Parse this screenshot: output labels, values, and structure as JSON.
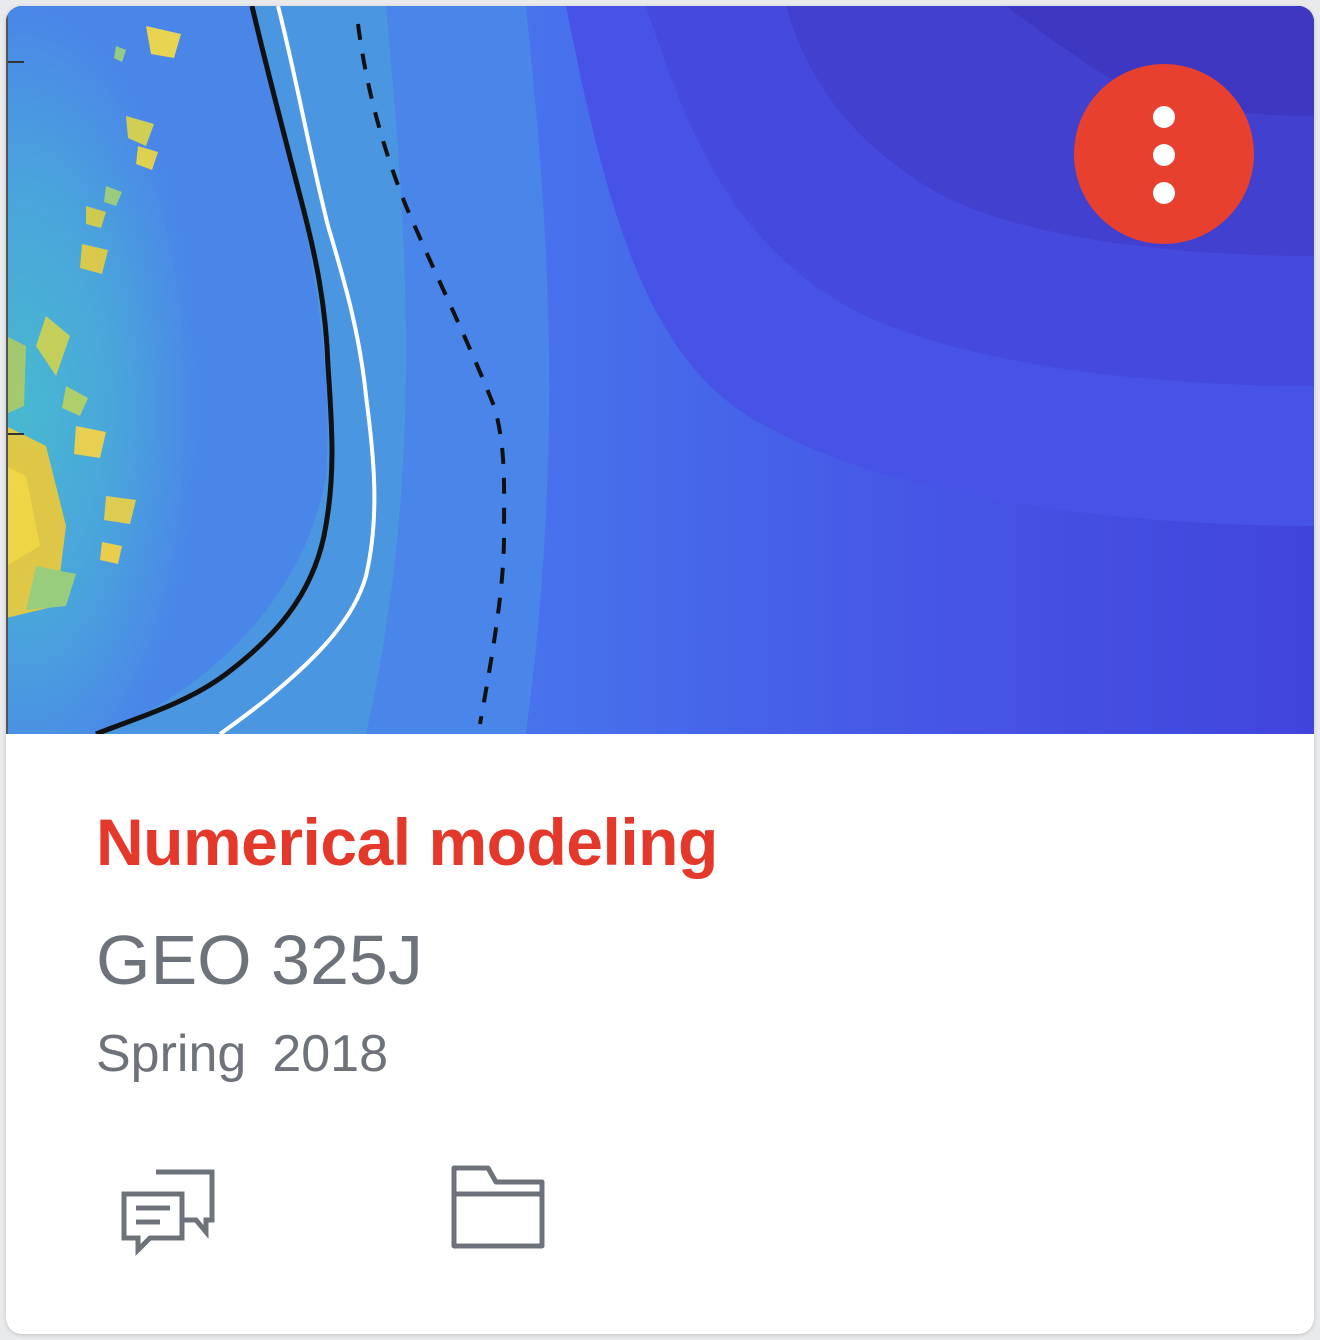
{
  "course": {
    "title": "Numerical modeling",
    "code": "GEO 325J",
    "term": {
      "season": "Spring",
      "year": "2018"
    }
  },
  "icons": {
    "menu": "more-vert-icon",
    "discussions": "discussions-icon",
    "files": "folder-icon"
  },
  "colors": {
    "accent": "#e4382b",
    "menu_button": "#e8402f",
    "secondary_text": "#6e737b",
    "icon": "#6e737b"
  }
}
